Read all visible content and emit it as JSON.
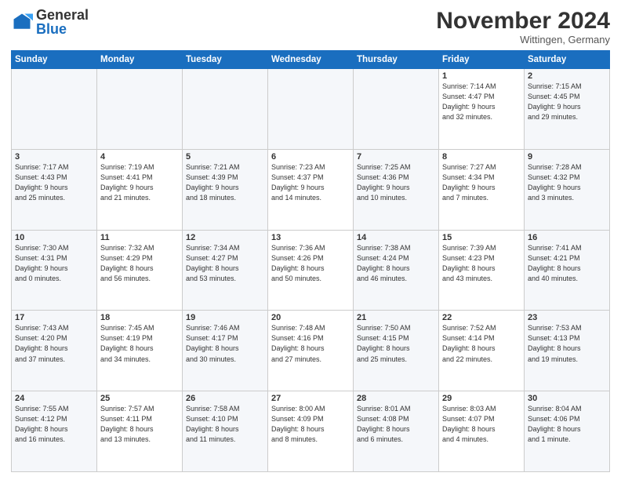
{
  "logo": {
    "general": "General",
    "blue": "Blue"
  },
  "title": "November 2024",
  "location": "Wittingen, Germany",
  "days_of_week": [
    "Sunday",
    "Monday",
    "Tuesday",
    "Wednesday",
    "Thursday",
    "Friday",
    "Saturday"
  ],
  "weeks": [
    [
      {
        "day": "",
        "info": ""
      },
      {
        "day": "",
        "info": ""
      },
      {
        "day": "",
        "info": ""
      },
      {
        "day": "",
        "info": ""
      },
      {
        "day": "",
        "info": ""
      },
      {
        "day": "1",
        "info": "Sunrise: 7:14 AM\nSunset: 4:47 PM\nDaylight: 9 hours\nand 32 minutes."
      },
      {
        "day": "2",
        "info": "Sunrise: 7:15 AM\nSunset: 4:45 PM\nDaylight: 9 hours\nand 29 minutes."
      }
    ],
    [
      {
        "day": "3",
        "info": "Sunrise: 7:17 AM\nSunset: 4:43 PM\nDaylight: 9 hours\nand 25 minutes."
      },
      {
        "day": "4",
        "info": "Sunrise: 7:19 AM\nSunset: 4:41 PM\nDaylight: 9 hours\nand 21 minutes."
      },
      {
        "day": "5",
        "info": "Sunrise: 7:21 AM\nSunset: 4:39 PM\nDaylight: 9 hours\nand 18 minutes."
      },
      {
        "day": "6",
        "info": "Sunrise: 7:23 AM\nSunset: 4:37 PM\nDaylight: 9 hours\nand 14 minutes."
      },
      {
        "day": "7",
        "info": "Sunrise: 7:25 AM\nSunset: 4:36 PM\nDaylight: 9 hours\nand 10 minutes."
      },
      {
        "day": "8",
        "info": "Sunrise: 7:27 AM\nSunset: 4:34 PM\nDaylight: 9 hours\nand 7 minutes."
      },
      {
        "day": "9",
        "info": "Sunrise: 7:28 AM\nSunset: 4:32 PM\nDaylight: 9 hours\nand 3 minutes."
      }
    ],
    [
      {
        "day": "10",
        "info": "Sunrise: 7:30 AM\nSunset: 4:31 PM\nDaylight: 9 hours\nand 0 minutes."
      },
      {
        "day": "11",
        "info": "Sunrise: 7:32 AM\nSunset: 4:29 PM\nDaylight: 8 hours\nand 56 minutes."
      },
      {
        "day": "12",
        "info": "Sunrise: 7:34 AM\nSunset: 4:27 PM\nDaylight: 8 hours\nand 53 minutes."
      },
      {
        "day": "13",
        "info": "Sunrise: 7:36 AM\nSunset: 4:26 PM\nDaylight: 8 hours\nand 50 minutes."
      },
      {
        "day": "14",
        "info": "Sunrise: 7:38 AM\nSunset: 4:24 PM\nDaylight: 8 hours\nand 46 minutes."
      },
      {
        "day": "15",
        "info": "Sunrise: 7:39 AM\nSunset: 4:23 PM\nDaylight: 8 hours\nand 43 minutes."
      },
      {
        "day": "16",
        "info": "Sunrise: 7:41 AM\nSunset: 4:21 PM\nDaylight: 8 hours\nand 40 minutes."
      }
    ],
    [
      {
        "day": "17",
        "info": "Sunrise: 7:43 AM\nSunset: 4:20 PM\nDaylight: 8 hours\nand 37 minutes."
      },
      {
        "day": "18",
        "info": "Sunrise: 7:45 AM\nSunset: 4:19 PM\nDaylight: 8 hours\nand 34 minutes."
      },
      {
        "day": "19",
        "info": "Sunrise: 7:46 AM\nSunset: 4:17 PM\nDaylight: 8 hours\nand 30 minutes."
      },
      {
        "day": "20",
        "info": "Sunrise: 7:48 AM\nSunset: 4:16 PM\nDaylight: 8 hours\nand 27 minutes."
      },
      {
        "day": "21",
        "info": "Sunrise: 7:50 AM\nSunset: 4:15 PM\nDaylight: 8 hours\nand 25 minutes."
      },
      {
        "day": "22",
        "info": "Sunrise: 7:52 AM\nSunset: 4:14 PM\nDaylight: 8 hours\nand 22 minutes."
      },
      {
        "day": "23",
        "info": "Sunrise: 7:53 AM\nSunset: 4:13 PM\nDaylight: 8 hours\nand 19 minutes."
      }
    ],
    [
      {
        "day": "24",
        "info": "Sunrise: 7:55 AM\nSunset: 4:12 PM\nDaylight: 8 hours\nand 16 minutes."
      },
      {
        "day": "25",
        "info": "Sunrise: 7:57 AM\nSunset: 4:11 PM\nDaylight: 8 hours\nand 13 minutes."
      },
      {
        "day": "26",
        "info": "Sunrise: 7:58 AM\nSunset: 4:10 PM\nDaylight: 8 hours\nand 11 minutes."
      },
      {
        "day": "27",
        "info": "Sunrise: 8:00 AM\nSunset: 4:09 PM\nDaylight: 8 hours\nand 8 minutes."
      },
      {
        "day": "28",
        "info": "Sunrise: 8:01 AM\nSunset: 4:08 PM\nDaylight: 8 hours\nand 6 minutes."
      },
      {
        "day": "29",
        "info": "Sunrise: 8:03 AM\nSunset: 4:07 PM\nDaylight: 8 hours\nand 4 minutes."
      },
      {
        "day": "30",
        "info": "Sunrise: 8:04 AM\nSunset: 4:06 PM\nDaylight: 8 hours\nand 1 minute."
      }
    ]
  ]
}
